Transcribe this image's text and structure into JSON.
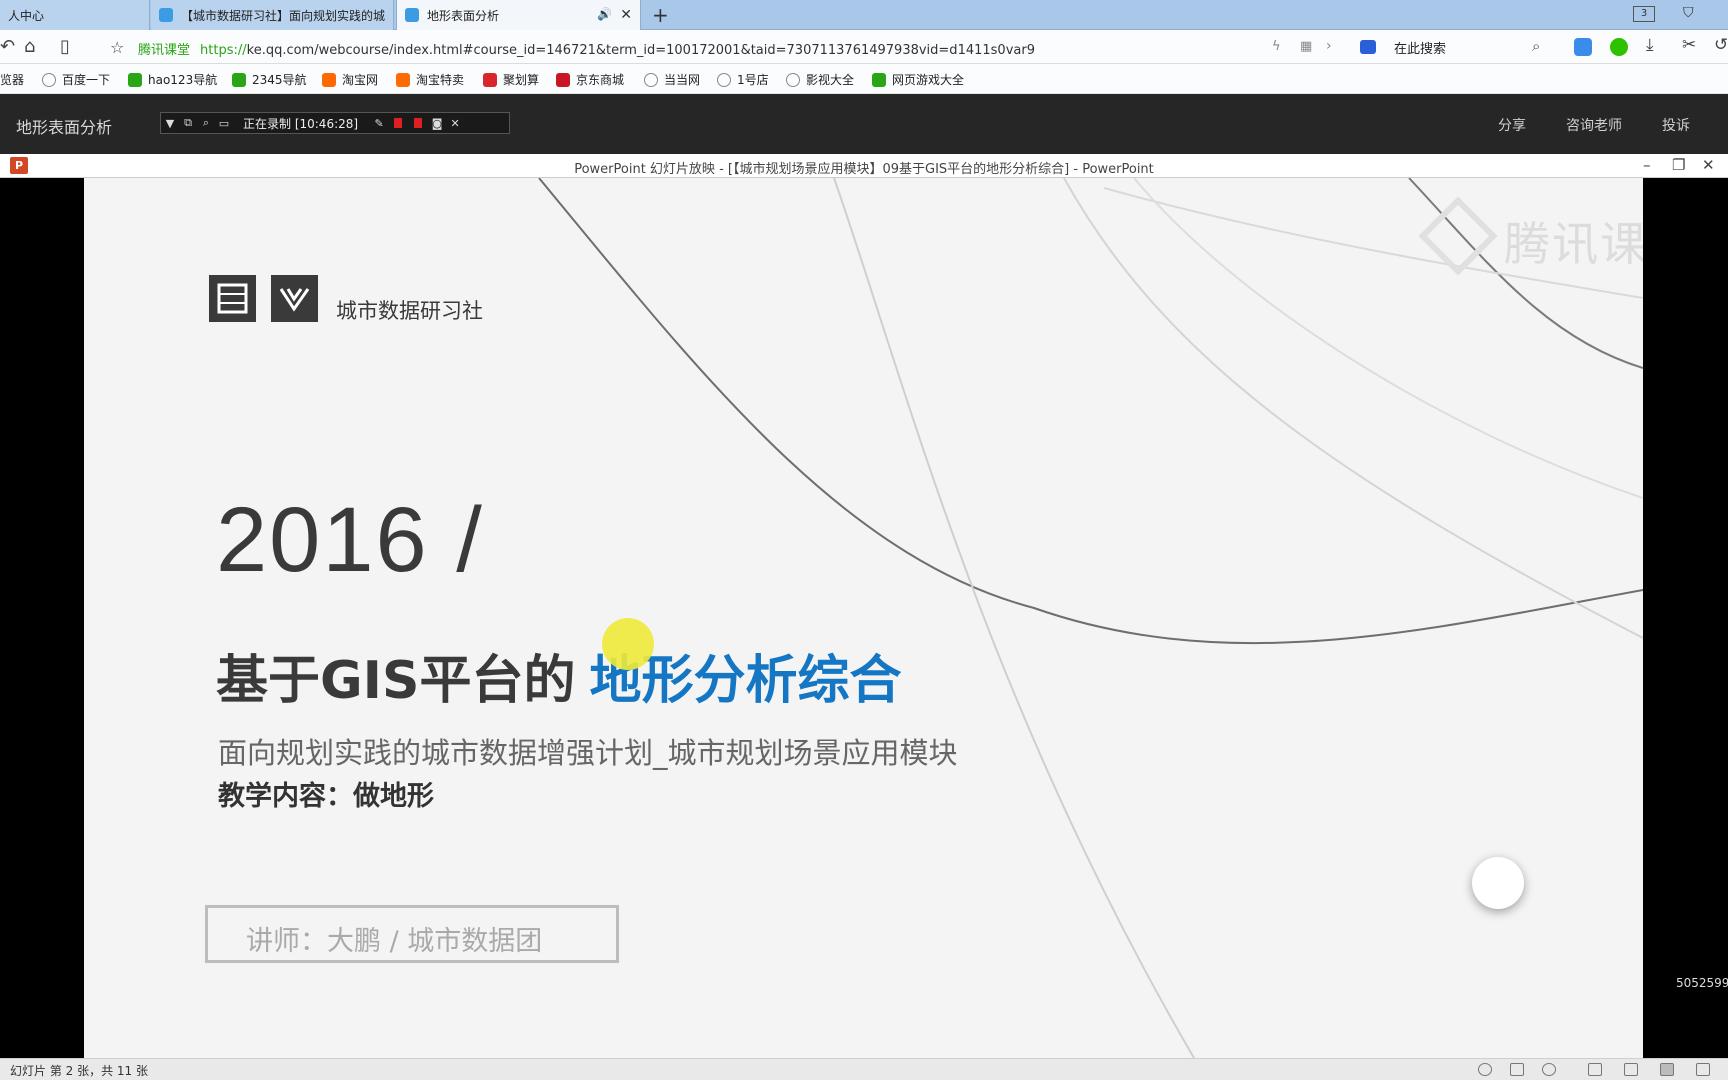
{
  "browser": {
    "tabs": [
      {
        "label": "人中心"
      },
      {
        "label": "【城市数据研习社】面向规划实践的城"
      },
      {
        "label": "地形表面分析",
        "active": true
      }
    ],
    "tab_count": "3",
    "address": {
      "site_label": "腾讯课堂",
      "url_scheme": "https://",
      "url_rest": "ke.qq.com/webcourse/index.html#course_id=146721&term_id=100172001&taid=7307113761497938vid=d1411s0var9"
    },
    "search_placeholder": "在此搜索",
    "bookmarks": [
      {
        "label": "览器",
        "color": "#4a90d9"
      },
      {
        "label": "百度一下",
        "color": "#888888"
      },
      {
        "label": "hao123导航",
        "color": "#2aa515"
      },
      {
        "label": "2345导航",
        "color": "#2aa515"
      },
      {
        "label": "淘宝网",
        "color": "#ff6a00"
      },
      {
        "label": "淘宝特卖",
        "color": "#ff6a00"
      },
      {
        "label": "聚划算",
        "color": "#d9262c"
      },
      {
        "label": "京东商城",
        "color": "#c81623"
      },
      {
        "label": "当当网",
        "color": "#888888"
      },
      {
        "label": "1号店",
        "color": "#888888"
      },
      {
        "label": "影视大全",
        "color": "#888888"
      },
      {
        "label": "网页游戏大全",
        "color": "#2aa515"
      }
    ]
  },
  "page_header": {
    "title": "地形表面分析",
    "recording_text": "正在录制 [10:46:28]",
    "links": [
      "分享",
      "咨询老师",
      "投诉"
    ]
  },
  "ppt": {
    "window_title": "PowerPoint 幻灯片放映 - [【城市规划场景应用模块】09基于GIS平台的地形分析综合] - PowerPoint",
    "status": "幻灯片 第 2 张，共 11 张",
    "side_id": "5052599"
  },
  "slide": {
    "brand": "城市数据研习社",
    "year": "2016 /",
    "title_dark": "基于GIS平台的",
    "title_highlight": "地形分析综合",
    "subtitle": "面向规划实践的城市数据增强计划_城市规划场景应用模块",
    "content": "教学内容：做地形",
    "lecturer": "讲师：大鹏 / 城市数据团",
    "watermark": "腾讯课堂",
    "colors": {
      "highlight": "#1577c4",
      "dark_text": "#3a3a3a"
    }
  }
}
